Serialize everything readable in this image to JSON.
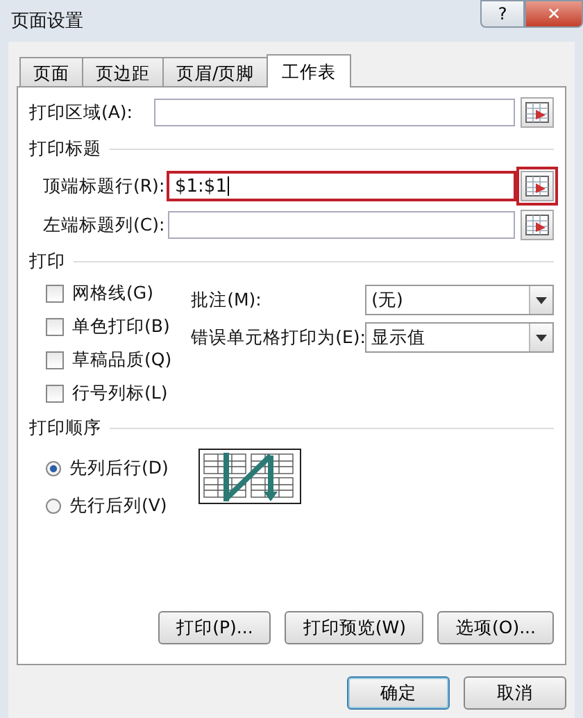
{
  "window": {
    "title": "页面设置",
    "help": "?",
    "close": "✕"
  },
  "tabs": [
    {
      "label": "页面",
      "selected": false
    },
    {
      "label": "页边距",
      "selected": false
    },
    {
      "label": "页眉/页脚",
      "selected": false
    },
    {
      "label": "工作表",
      "selected": true
    }
  ],
  "print_area": {
    "label": "打印区域(A):",
    "highlighted": false
  },
  "print_titles": {
    "heading": "打印标题",
    "fields": [
      {
        "label": "顶端标题行(R):",
        "value": "$1:$1",
        "highlighted": true
      },
      {
        "label": "左端标题列(C):",
        "highlighted": false
      }
    ]
  },
  "print": {
    "heading": "打印",
    "checkboxes": [
      {
        "label": "网格线(G)",
        "checked": false
      },
      {
        "label": "单色打印(B)",
        "checked": false
      },
      {
        "label": "草稿品质(Q)",
        "checked": false
      },
      {
        "label": "行号列标(L)",
        "checked": false
      }
    ],
    "dropdowns": [
      {
        "label": "批注(M):",
        "value": "(无)"
      },
      {
        "label": "错误单元格打印为(E):",
        "value": "显示值"
      }
    ]
  },
  "print_order": {
    "heading": "打印顺序",
    "options": [
      {
        "label": "先列后行(D)",
        "selected": true
      },
      {
        "label": "先行后列(V)",
        "selected": false
      }
    ]
  },
  "panel_buttons": [
    "打印(P)...",
    "打印预览(W)",
    "选项(O)..."
  ],
  "dialog_buttons": [
    "确定",
    "取消"
  ]
}
